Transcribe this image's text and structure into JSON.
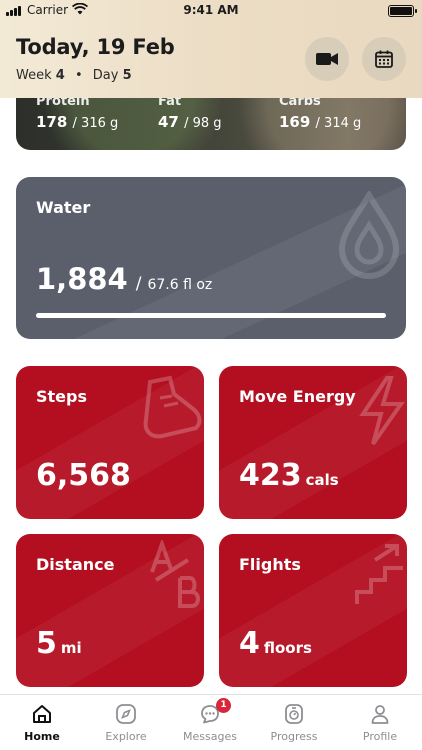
{
  "status_bar": {
    "carrier": "Carrier",
    "time": "9:41 AM"
  },
  "header": {
    "title": "Today, 19 Feb",
    "week_label": "Week",
    "week_value": "4",
    "day_label": "Day",
    "day_value": "5",
    "separator": "•"
  },
  "macros": {
    "protein": {
      "label": "Protein",
      "value": "178",
      "goal": "/ 316 g"
    },
    "fat": {
      "label": "Fat",
      "value": "47",
      "goal": "/ 98 g"
    },
    "carbs": {
      "label": "Carbs",
      "value": "169",
      "goal": "/ 314 g"
    }
  },
  "water": {
    "title": "Water",
    "value": "1,884",
    "separator": "/",
    "goal": "67.6 fl oz",
    "progress": 1.0
  },
  "steps": {
    "title": "Steps",
    "value": "6,568"
  },
  "move_energy": {
    "title": "Move Energy",
    "value": "423",
    "unit": "cals"
  },
  "distance": {
    "title": "Distance",
    "value": "5",
    "unit": "mi"
  },
  "flights": {
    "title": "Flights",
    "value": "4",
    "unit": "floors"
  },
  "tabs": [
    {
      "label": "Home",
      "icon": "home-icon",
      "active": true
    },
    {
      "label": "Explore",
      "icon": "compass-icon"
    },
    {
      "label": "Messages",
      "icon": "chat-icon",
      "badge": "1"
    },
    {
      "label": "Progress",
      "icon": "progress-icon"
    },
    {
      "label": "Profile",
      "icon": "person-icon"
    }
  ],
  "colors": {
    "header_bg": "#ecddc5",
    "water_card": "#5a5f6b",
    "stat_card": "#b30f20",
    "badge": "#d9263a"
  }
}
